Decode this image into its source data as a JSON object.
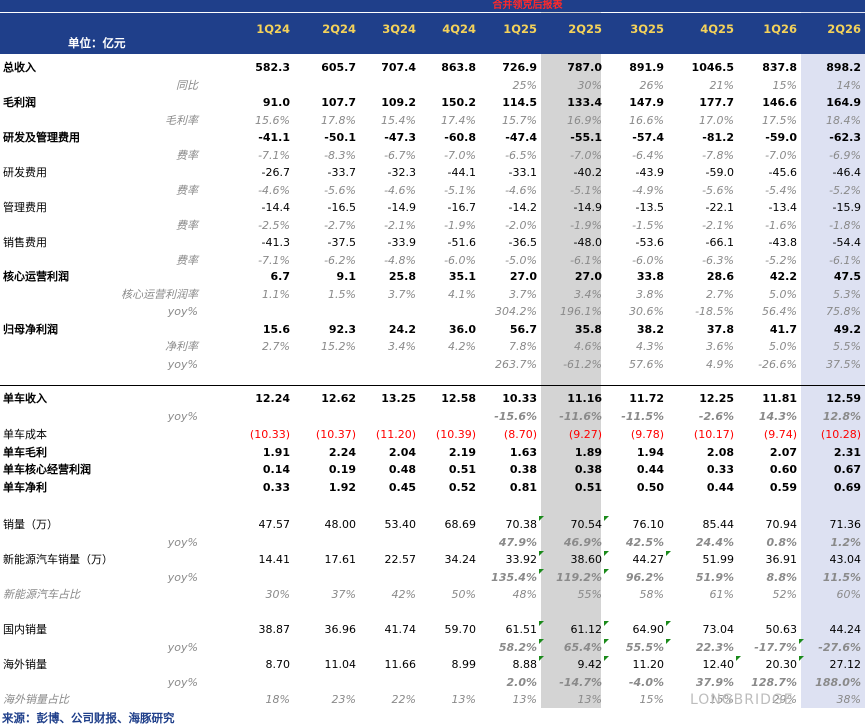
{
  "title": "合并领克后报表",
  "unit_label": "单位：亿元",
  "quarters": [
    "1Q24",
    "2Q24",
    "3Q24",
    "4Q24",
    "1Q25",
    "2Q25",
    "3Q25",
    "4Q25",
    "1Q26",
    "2Q26"
  ],
  "rows": [
    {
      "label": "总收入",
      "style": "bold",
      "values": [
        "582.3",
        "605.7",
        "707.4",
        "863.8",
        "726.9",
        "787.0",
        "891.9",
        "1046.5",
        "837.8",
        "898.2"
      ]
    },
    {
      "sub": "同比",
      "style": "it",
      "values": [
        "",
        "",
        "",
        "",
        "25%",
        "30%",
        "26%",
        "21%",
        "15%",
        "14%"
      ]
    },
    {
      "label": "毛利润",
      "style": "bold",
      "values": [
        "91.0",
        "107.7",
        "109.2",
        "150.2",
        "114.5",
        "133.4",
        "147.9",
        "177.7",
        "146.6",
        "164.9"
      ]
    },
    {
      "sub": "毛利率",
      "style": "it",
      "values": [
        "15.6%",
        "17.8%",
        "15.4%",
        "17.4%",
        "15.7%",
        "16.9%",
        "16.6%",
        "17.0%",
        "17.5%",
        "18.4%"
      ]
    },
    {
      "label": "研发及管理费用",
      "style": "bold",
      "values": [
        "-41.1",
        "-50.1",
        "-47.3",
        "-60.8",
        "-47.4",
        "-55.1",
        "-57.4",
        "-81.2",
        "-59.0",
        "-62.3"
      ]
    },
    {
      "sub": "费率",
      "style": "it",
      "values": [
        "-7.1%",
        "-8.3%",
        "-6.7%",
        "-7.0%",
        "-6.5%",
        "-7.0%",
        "-6.4%",
        "-7.8%",
        "-7.0%",
        "-6.9%"
      ]
    },
    {
      "label": "研发费用",
      "style": "",
      "values": [
        "-26.7",
        "-33.7",
        "-32.3",
        "-44.1",
        "-33.1",
        "-40.2",
        "-43.9",
        "-59.0",
        "-45.6",
        "-46.4"
      ]
    },
    {
      "sub": "费率",
      "style": "it",
      "values": [
        "-4.6%",
        "-5.6%",
        "-4.6%",
        "-5.1%",
        "-4.6%",
        "-5.1%",
        "-4.9%",
        "-5.6%",
        "-5.4%",
        "-5.2%"
      ]
    },
    {
      "label": "管理费用",
      "style": "",
      "values": [
        "-14.4",
        "-16.5",
        "-14.9",
        "-16.7",
        "-14.2",
        "-14.9",
        "-13.5",
        "-22.1",
        "-13.4",
        "-15.9"
      ]
    },
    {
      "sub": "费率",
      "style": "it",
      "values": [
        "-2.5%",
        "-2.7%",
        "-2.1%",
        "-1.9%",
        "-2.0%",
        "-1.9%",
        "-1.5%",
        "-2.1%",
        "-1.6%",
        "-1.8%"
      ]
    },
    {
      "label": "销售费用",
      "style": "",
      "values": [
        "-41.3",
        "-37.5",
        "-33.9",
        "-51.6",
        "-36.5",
        "-48.0",
        "-53.6",
        "-66.1",
        "-43.8",
        "-54.4"
      ]
    },
    {
      "sub": "费率",
      "style": "it",
      "values": [
        "-7.1%",
        "-6.2%",
        "-4.8%",
        "-6.0%",
        "-5.0%",
        "-6.1%",
        "-6.0%",
        "-6.3%",
        "-5.2%",
        "-6.1%"
      ]
    },
    {
      "label": "核心运营利润",
      "style": "bold",
      "values": [
        "6.7",
        "9.1",
        "25.8",
        "35.1",
        "27.0",
        "27.0",
        "33.8",
        "28.6",
        "42.2",
        "47.5"
      ]
    },
    {
      "sub": "核心运营利润率",
      "style": "it",
      "values": [
        "1.1%",
        "1.5%",
        "3.7%",
        "4.1%",
        "3.7%",
        "3.4%",
        "3.8%",
        "2.7%",
        "5.0%",
        "5.3%"
      ]
    },
    {
      "sub": "yoy%",
      "style": "it",
      "values": [
        "",
        "",
        "",
        "",
        "304.2%",
        "196.1%",
        "30.6%",
        "-18.5%",
        "56.4%",
        "75.8%"
      ]
    },
    {
      "label": "归母净利润",
      "style": "bold",
      "values": [
        "15.6",
        "92.3",
        "24.2",
        "36.0",
        "56.7",
        "35.8",
        "38.2",
        "37.8",
        "41.7",
        "49.2"
      ]
    },
    {
      "sub": "净利率",
      "style": "it",
      "values": [
        "2.7%",
        "15.2%",
        "3.4%",
        "4.2%",
        "7.8%",
        "4.6%",
        "4.3%",
        "3.6%",
        "5.0%",
        "5.5%"
      ]
    },
    {
      "sub": "yoy%",
      "style": "it",
      "values": [
        "",
        "",
        "",
        "",
        "263.7%",
        "-61.2%",
        "57.6%",
        "4.9%",
        "-26.6%",
        "37.5%"
      ]
    },
    {
      "label": "单车收入",
      "style": "bold",
      "values": [
        "12.24",
        "12.62",
        "13.25",
        "12.58",
        "10.33",
        "11.16",
        "11.72",
        "12.25",
        "11.81",
        "12.59"
      ]
    },
    {
      "sub": "yoy%",
      "style": "itb",
      "values": [
        "",
        "",
        "",
        "",
        "-15.6%",
        "-11.6%",
        "-11.5%",
        "-2.6%",
        "14.3%",
        "12.8%"
      ]
    },
    {
      "label": "单车成本",
      "style": "red",
      "values": [
        "(10.33)",
        "(10.37)",
        "(11.20)",
        "(10.39)",
        "(8.70)",
        "(9.27)",
        "(9.78)",
        "(10.17)",
        "(9.74)",
        "(10.28)"
      ]
    },
    {
      "label": "单车毛利",
      "style": "bold",
      "values": [
        "1.91",
        "2.24",
        "2.04",
        "2.19",
        "1.63",
        "1.89",
        "1.94",
        "2.08",
        "2.07",
        "2.31"
      ]
    },
    {
      "label": "单车核心经营利润",
      "style": "bold",
      "values": [
        "0.14",
        "0.19",
        "0.48",
        "0.51",
        "0.38",
        "0.38",
        "0.44",
        "0.33",
        "0.60",
        "0.67"
      ]
    },
    {
      "label": "单车净利",
      "style": "bold",
      "values": [
        "0.33",
        "1.92",
        "0.45",
        "0.52",
        "0.81",
        "0.51",
        "0.50",
        "0.44",
        "0.59",
        "0.69"
      ]
    },
    {
      "label": "销量（万）",
      "style": "",
      "values": [
        "47.57",
        "48.00",
        "53.40",
        "68.69",
        "70.38",
        "70.54",
        "76.10",
        "85.44",
        "70.94",
        "71.36"
      ]
    },
    {
      "sub": "yoy%",
      "style": "itb",
      "values": [
        "",
        "",
        "",
        "",
        "47.9%",
        "46.9%",
        "42.5%",
        "24.4%",
        "0.8%",
        "1.2%"
      ]
    },
    {
      "label": "新能源汽车销量（万）",
      "style": "",
      "values": [
        "14.41",
        "17.61",
        "22.57",
        "34.24",
        "33.92",
        "38.60",
        "44.27",
        "51.99",
        "36.91",
        "43.04"
      ]
    },
    {
      "sub": "yoy%",
      "style": "itb",
      "values": [
        "",
        "",
        "",
        "",
        "135.4%",
        "119.2%",
        "96.2%",
        "51.9%",
        "8.8%",
        "11.5%"
      ]
    },
    {
      "label": "新能源汽车占比",
      "style": "it",
      "values": [
        "30%",
        "37%",
        "42%",
        "50%",
        "48%",
        "55%",
        "58%",
        "61%",
        "52%",
        "60%"
      ]
    },
    {
      "label": "国内销量",
      "style": "",
      "values": [
        "38.87",
        "36.96",
        "41.74",
        "59.70",
        "61.51",
        "61.12",
        "64.90",
        "73.04",
        "50.63",
        "44.24"
      ]
    },
    {
      "sub": "yoy%",
      "style": "itb",
      "values": [
        "",
        "",
        "",
        "",
        "58.2%",
        "65.4%",
        "55.5%",
        "22.3%",
        "-17.7%",
        "-27.6%"
      ]
    },
    {
      "label": "海外销量",
      "style": "",
      "values": [
        "8.70",
        "11.04",
        "11.66",
        "8.99",
        "8.88",
        "9.42",
        "11.20",
        "12.40",
        "20.30",
        "27.12"
      ]
    },
    {
      "sub": "yoy%",
      "style": "itb",
      "values": [
        "",
        "",
        "",
        "",
        "2.0%",
        "-14.7%",
        "-4.0%",
        "37.9%",
        "128.7%",
        "188.0%"
      ]
    },
    {
      "label": "海外销量占比",
      "style": "it",
      "values": [
        "18%",
        "23%",
        "22%",
        "13%",
        "13%",
        "13%",
        "15%",
        "15%",
        "29%",
        "38%"
      ]
    }
  ],
  "source": "来源：彭博、公司财报、海豚研究",
  "watermark": "LONGBRIDGE"
}
